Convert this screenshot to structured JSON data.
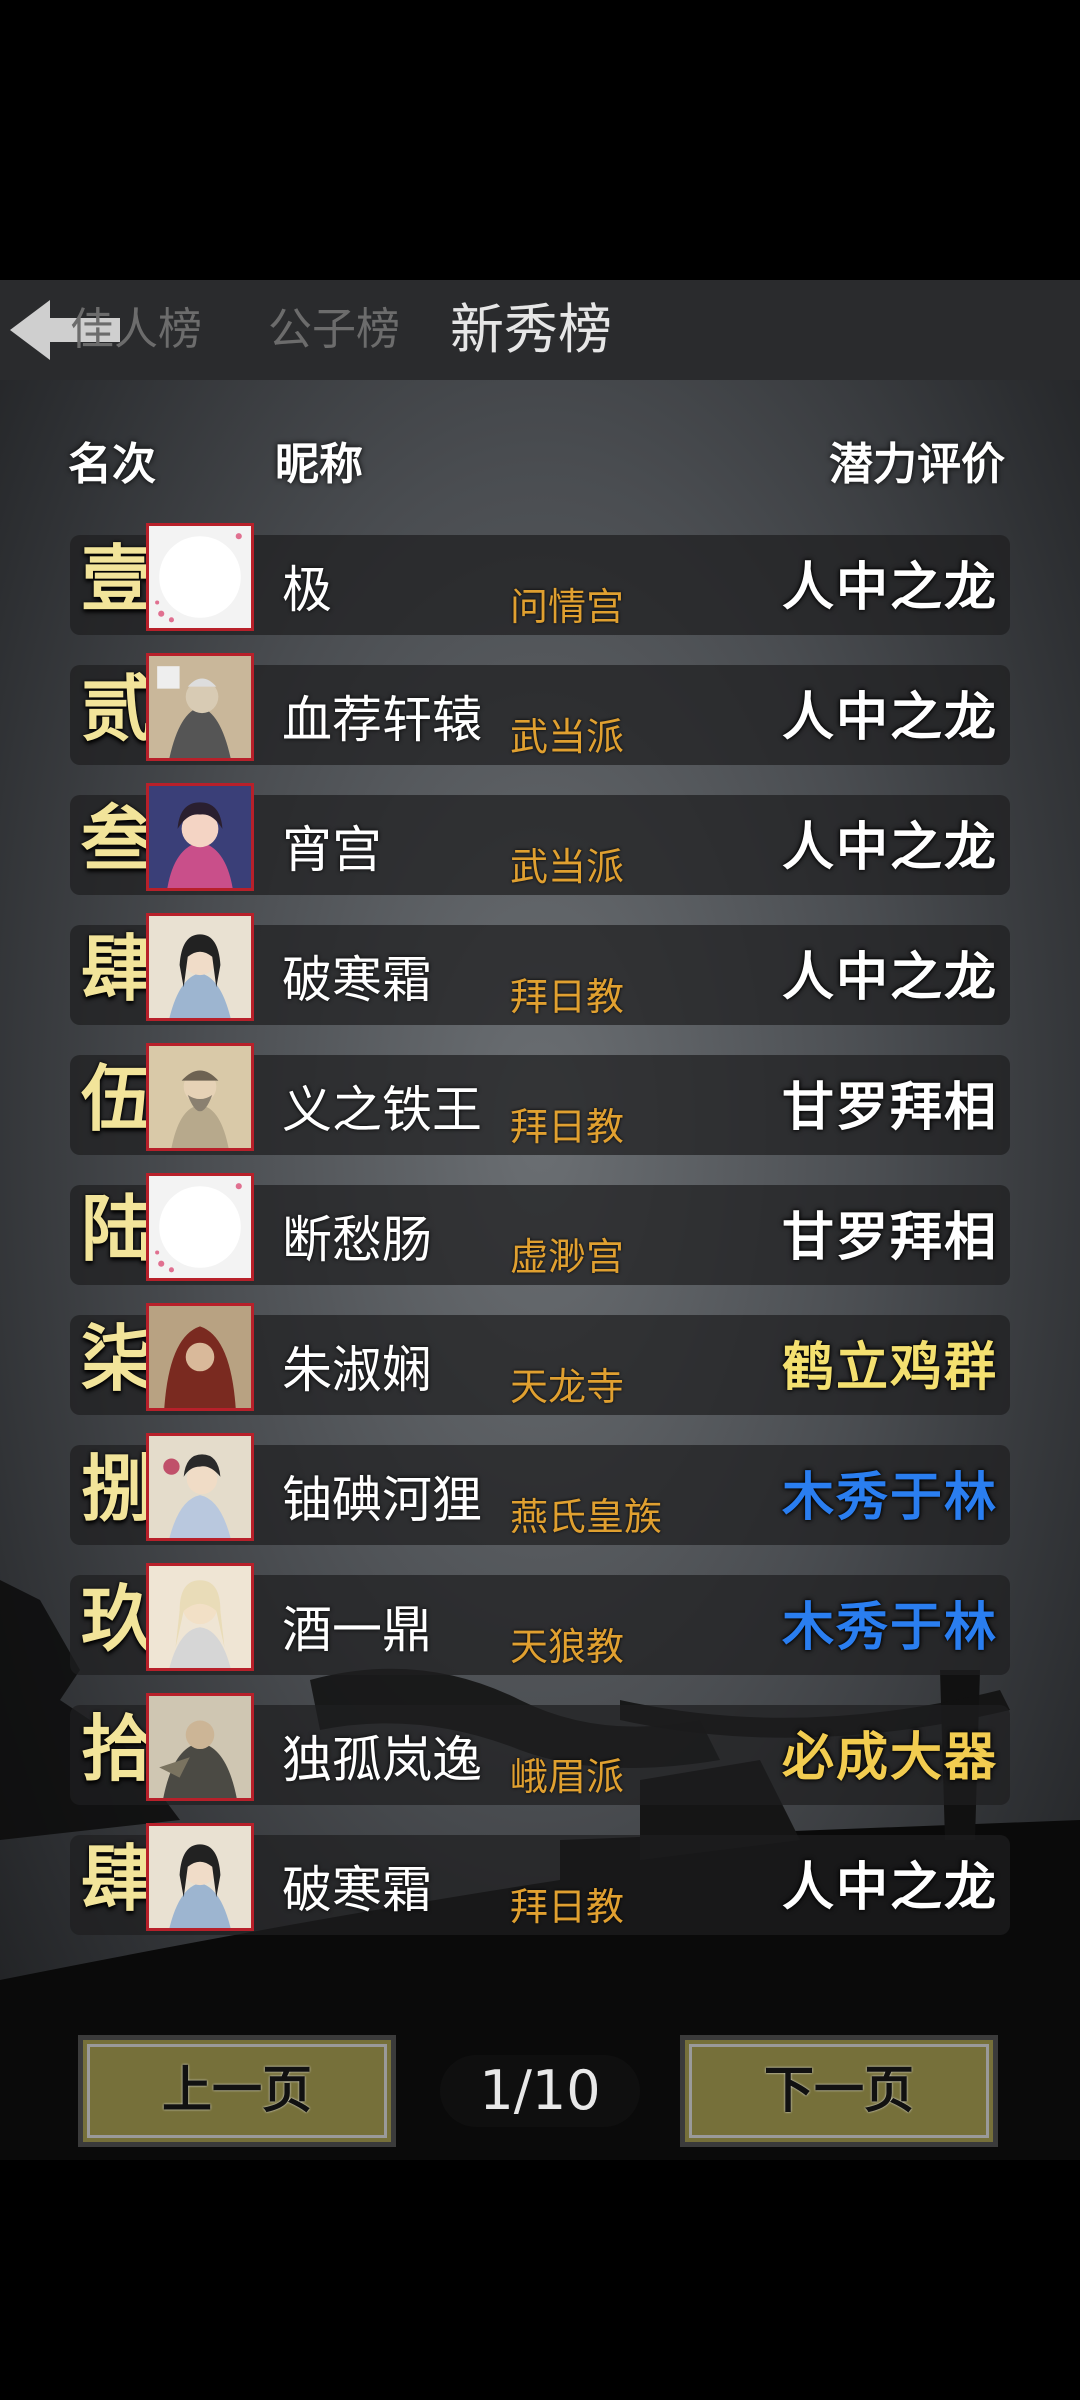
{
  "tabs": [
    {
      "label": "佳人榜"
    },
    {
      "label": "公子榜"
    },
    {
      "label": "新秀榜"
    }
  ],
  "headers": {
    "rank": "名次",
    "name": "昵称",
    "rating": "潜力评价"
  },
  "rows": [
    {
      "rank": "壹",
      "name": "极",
      "sect": "问情宫",
      "rating": "人中之龙",
      "rating_color": "#ffffff",
      "avatar": "blank-portrait"
    },
    {
      "rank": "贰",
      "name": "血荐轩辕",
      "sect": "武当派",
      "rating": "人中之龙",
      "rating_color": "#ffffff",
      "avatar": "elder-portrait"
    },
    {
      "rank": "叁",
      "name": "宵宫",
      "sect": "武当派",
      "rating": "人中之龙",
      "rating_color": "#ffffff",
      "avatar": "girl-portrait"
    },
    {
      "rank": "肆",
      "name": "破寒霜",
      "sect": "拜日教",
      "rating": "人中之龙",
      "rating_color": "#ffffff",
      "avatar": "swordsman-portrait"
    },
    {
      "rank": "伍",
      "name": "义之铁王",
      "sect": "拜日教",
      "rating": "甘罗拜相",
      "rating_color": "#ffffff",
      "avatar": "bearded-portrait"
    },
    {
      "rank": "陆",
      "name": "断愁肠",
      "sect": "虚渺宫",
      "rating": "甘罗拜相",
      "rating_color": "#ffffff",
      "avatar": "blank-portrait"
    },
    {
      "rank": "柒",
      "name": "朱淑娴",
      "sect": "天龙寺",
      "rating": "鹤立鸡群",
      "rating_color": "#f4e070",
      "avatar": "hooded-portrait"
    },
    {
      "rank": "捌",
      "name": "铀碘河狸",
      "sect": "燕氏皇族",
      "rating": "木秀于林",
      "rating_color": "#2a7ef0",
      "avatar": "scholar-portrait"
    },
    {
      "rank": "玖",
      "name": "酒一鼎",
      "sect": "天狼教",
      "rating": "木秀于林",
      "rating_color": "#2a7ef0",
      "avatar": "monk-portrait"
    },
    {
      "rank": "拾",
      "name": "独孤岚逸",
      "sect": "峨眉派",
      "rating": "必成大器",
      "rating_color": "#f2cc50",
      "avatar": "warrior-portrait"
    },
    {
      "rank": "肆",
      "name": "破寒霜",
      "sect": "拜日教",
      "rating": "人中之龙",
      "rating_color": "#ffffff",
      "avatar": "swordsman-portrait"
    }
  ],
  "pager": {
    "prev_label": "上一页",
    "next_label": "下一页",
    "page": "1/10"
  },
  "colors": {
    "sect": "#e0a030",
    "rank": "#f2e49a",
    "button": "#76703a"
  }
}
